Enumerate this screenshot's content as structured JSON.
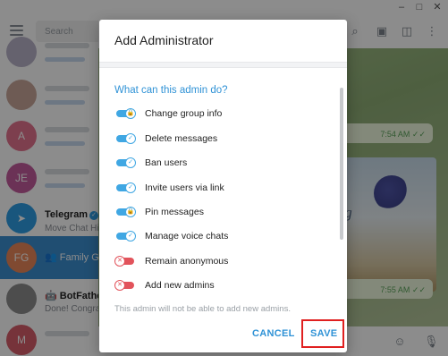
{
  "sidebar": {
    "search_placeholder": "Search",
    "chats": [
      {
        "avatar_letter": "A",
        "avatar_color": "#e4738e"
      },
      {
        "avatar_letter": "JE",
        "avatar_color": "#c45c9d"
      },
      {
        "name": "Telegram",
        "preview": "Move Chat Hi",
        "avatar_color": "#2f9de3"
      },
      {
        "name": "Family Gr",
        "avatar_letter": "FG",
        "avatar_color": "#e9875a"
      },
      {
        "name": "BotFathe",
        "preview": "Done! Congra"
      },
      {
        "avatar_letter": "M",
        "avatar_color": "#d85d6a"
      }
    ]
  },
  "chat": {
    "message_times": [
      "7:54 AM",
      "7:55 AM"
    ],
    "photo_text": "ing"
  },
  "dialog": {
    "title": "Add Administrator",
    "section_title": "What can this admin do?",
    "permissions": [
      {
        "label": "Change group info",
        "enabled": true,
        "locked": true
      },
      {
        "label": "Delete messages",
        "enabled": true,
        "locked": false
      },
      {
        "label": "Ban users",
        "enabled": true,
        "locked": false
      },
      {
        "label": "Invite users via link",
        "enabled": true,
        "locked": false
      },
      {
        "label": "Pin messages",
        "enabled": true,
        "locked": true
      },
      {
        "label": "Manage voice chats",
        "enabled": true,
        "locked": false
      },
      {
        "label": "Remain anonymous",
        "enabled": false,
        "locked": false
      },
      {
        "label": "Add new admins",
        "enabled": false,
        "locked": false
      }
    ],
    "note": "This admin will not be able to add new admins.",
    "cancel_label": "CANCEL",
    "save_label": "SAVE"
  },
  "colors": {
    "accent": "#40a7e3",
    "toggle_off": "#e2535b",
    "highlight": "#e02020"
  }
}
